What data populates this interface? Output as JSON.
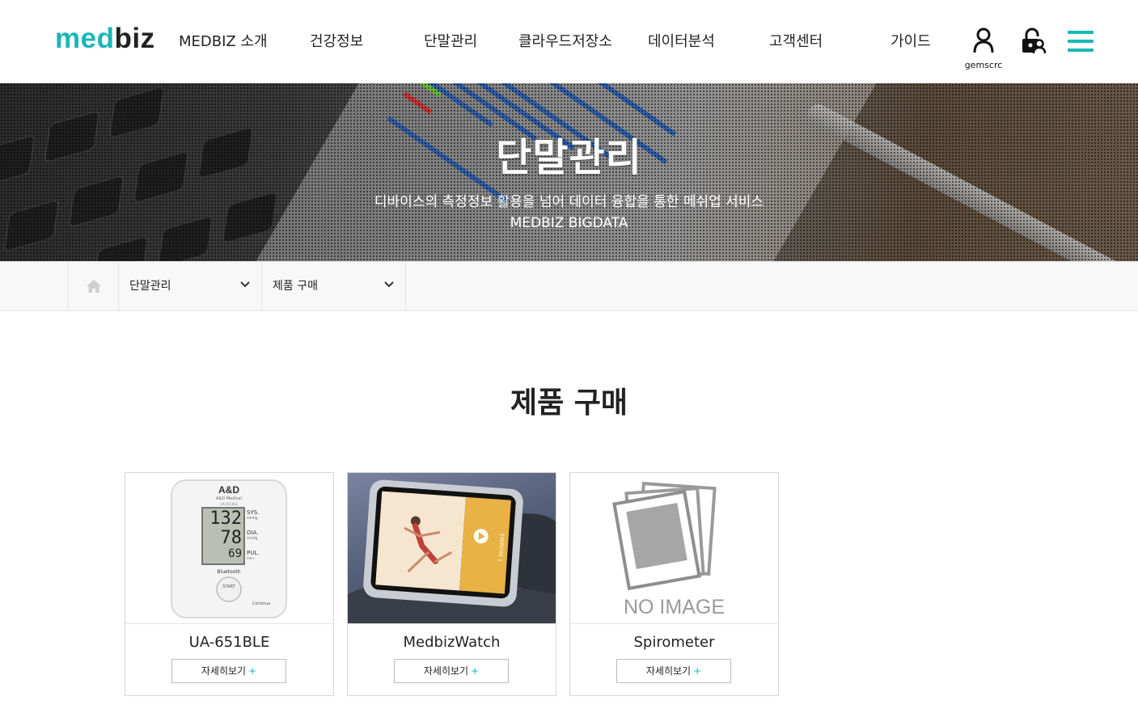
{
  "header": {
    "logo_part1": "med",
    "logo_part2": "biz",
    "nav": [
      {
        "label": "MEDBIZ 소개"
      },
      {
        "label": "건강정보"
      },
      {
        "label": "단말관리"
      },
      {
        "label": "클라우드저장소"
      },
      {
        "label": "데이터분석"
      },
      {
        "label": "고객센터"
      },
      {
        "label": "가이드"
      }
    ],
    "username": "gemscrc",
    "accent_color": "#19b7b8"
  },
  "banner": {
    "title": "단말관리",
    "subtitle_line1": "디바이스의 측정정보 활용을 넘어 데이터 융합을 통한 메쉬업 서비스",
    "subtitle_line2": "MEDBIZ BIGDATA"
  },
  "breadcrumb": {
    "home_icon": "home-icon",
    "level1": "단말관리",
    "level2": "제품 구매"
  },
  "main": {
    "title": "제품 구매",
    "products": [
      {
        "name": "UA-651BLE",
        "button": "자세히보기",
        "image": {
          "brand": "A&D",
          "brand_sub": "A&D Medical",
          "model": "UA-651BLE",
          "sys_value": "132",
          "sys_label": "SYS.",
          "dia_value": "78",
          "dia_label": "DIA.",
          "pul_value": "69",
          "pul_label": "PUL.",
          "unit_mmhg": "mmHg",
          "unit_min": "/min.",
          "bluetooth": "Bluetooth",
          "start": "START",
          "continua": "Continua"
        }
      },
      {
        "name": "MedbizWatch",
        "button": "자세히보기",
        "image": {
          "screen_label": "EXERCISE 1"
        }
      },
      {
        "name": "Spirometer",
        "button": "자세히보기",
        "image": {
          "placeholder": "NO IMAGE"
        }
      }
    ]
  }
}
